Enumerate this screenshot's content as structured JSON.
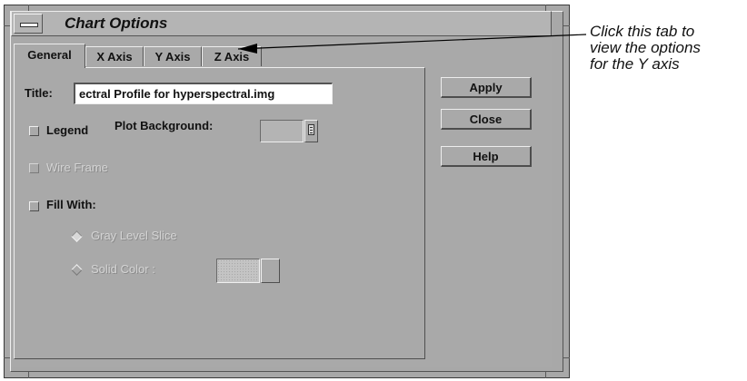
{
  "window": {
    "title": "Chart Options"
  },
  "tabs": [
    {
      "label": "General",
      "active": true
    },
    {
      "label": "X Axis",
      "active": false
    },
    {
      "label": "Y Axis",
      "active": false
    },
    {
      "label": "Z Axis",
      "active": false
    }
  ],
  "general": {
    "title_label": "Title:",
    "title_value": "ectral Profile for hyperspectral.img",
    "legend_label": "Legend",
    "plot_background_label": "Plot Background:",
    "wire_frame_label": "Wire Frame",
    "fill_with_label": "Fill With:",
    "gray_level_label": "Gray Level Slice",
    "solid_color_label": "Solid Color :"
  },
  "buttons": {
    "apply": "Apply",
    "close": "Close",
    "help": "Help"
  },
  "annotation": {
    "lines": [
      "Click this tab to",
      "view the options",
      "for the Y axis"
    ]
  }
}
